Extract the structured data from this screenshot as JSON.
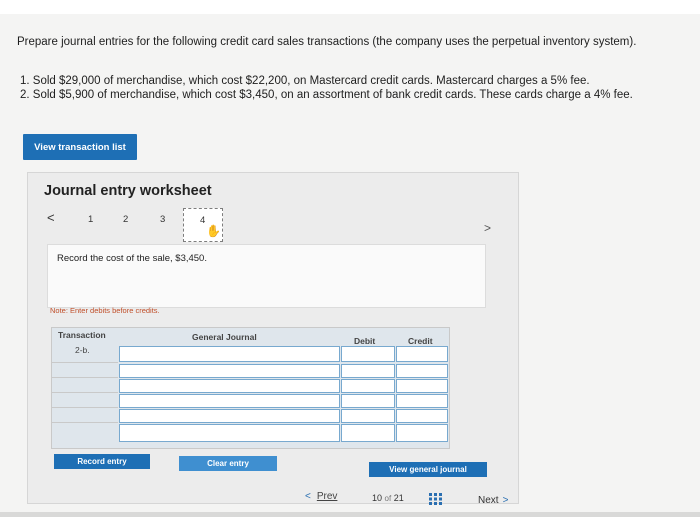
{
  "question": {
    "prompt": "Prepare journal entries for the following credit card sales transactions (the company uses the perpetual inventory system).",
    "items": [
      "1. Sold $29,000 of merchandise, which cost $22,200, on Mastercard credit cards. Mastercard charges a 5% fee.",
      "2. Sold $5,900 of merchandise, which cost $3,450, on an assortment of bank credit cards. These cards charge a 4% fee."
    ]
  },
  "buttons": {
    "view_transactions": "View transaction list",
    "record_entry": "Record entry",
    "clear_entry": "Clear entry",
    "view_general_journal": "View general journal"
  },
  "worksheet": {
    "title": "Journal entry worksheet",
    "steps": [
      "1",
      "2",
      "3",
      "4"
    ],
    "active_step": "4",
    "instruction": "Record the cost of the sale, $3,450.",
    "note": "Note: Enter debits before credits."
  },
  "table": {
    "headers": {
      "transaction": "Transaction",
      "general_journal": "General Journal",
      "debit": "Debit",
      "credit": "Credit"
    },
    "transaction_label": "2-b.",
    "rows": [
      {
        "account": "",
        "debit": "",
        "credit": ""
      },
      {
        "account": "",
        "debit": "",
        "credit": ""
      },
      {
        "account": "",
        "debit": "",
        "credit": ""
      },
      {
        "account": "",
        "debit": "",
        "credit": ""
      },
      {
        "account": "",
        "debit": "",
        "credit": ""
      },
      {
        "account": "",
        "debit": "",
        "credit": ""
      }
    ]
  },
  "pager": {
    "prev_label": "Prev",
    "current": "10",
    "of_label": "of",
    "total": "21",
    "next_label": "Next"
  },
  "colors": {
    "primary_button": "#1e6fb5",
    "input_border": "#78a9cf",
    "note_text": "#c04f2a"
  }
}
